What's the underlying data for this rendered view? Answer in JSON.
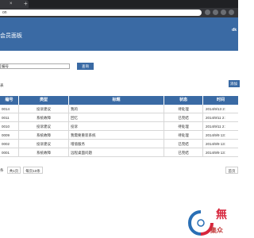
{
  "browser": {
    "tab_close": "×",
    "new_tab": "+",
    "address_text": "on"
  },
  "header": {
    "title": "会员面板",
    "user": "dk"
  },
  "search": {
    "select_value": "编号",
    "button_label": "查询"
  },
  "section": {
    "label": "表",
    "right_button": "添加"
  },
  "table": {
    "columns": [
      "编号",
      "类型",
      "标题",
      "状态",
      "时间"
    ],
    "rows": [
      {
        "id": "0014",
        "type": "投诉建议",
        "title": "我的",
        "status": "待处理",
        "time": "2014/9/13 2:"
      },
      {
        "id": "0011",
        "type": "系统故障",
        "title": "回忆",
        "status": "已完结",
        "time": "2014/9/11 2:"
      },
      {
        "id": "0010",
        "type": "投诉建议",
        "title": "投诉",
        "status": "待处理",
        "time": "2014/9/11 2:"
      },
      {
        "id": "0009",
        "type": "系统故障",
        "title": "我需要重装系统",
        "status": "待处理",
        "time": "2014/9/9 13:"
      },
      {
        "id": "0002",
        "type": "投诉建议",
        "title": "增值服务",
        "status": "已完结",
        "time": "2014/9/9 13:"
      },
      {
        "id": "0001",
        "type": "系统故障",
        "title": "远程桌面问题",
        "status": "已完结",
        "time": "2014/9/9 13:"
      }
    ]
  },
  "pager": {
    "records": "条",
    "total_pages": "共1页",
    "per_page": "每页10条",
    "home": "首页"
  },
  "watermark": {
    "top": "無",
    "bottom": "集众"
  },
  "colors": {
    "header": "#3a6aa4",
    "accent": "#3a6aa4"
  }
}
